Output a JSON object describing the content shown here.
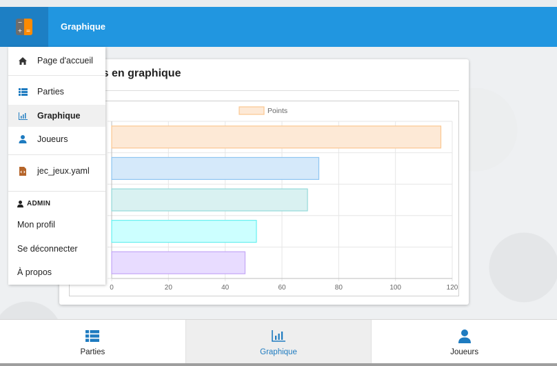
{
  "app": {
    "title": "Graphique",
    "logo_icon": "calculator-icon",
    "accent": "#2196e0"
  },
  "card": {
    "title_visible": "sultats en graphique"
  },
  "drawer": {
    "items": [
      {
        "label": "Page d'accueil",
        "icon": "home-icon"
      },
      {
        "label": "Parties",
        "icon": "list-icon"
      },
      {
        "label": "Graphique",
        "icon": "chart-icon",
        "active": true
      },
      {
        "label": "Joueurs",
        "icon": "user-icon"
      },
      {
        "label": "jec_jeux.yaml",
        "icon": "file-code-icon"
      }
    ],
    "admin_section": "ADMIN",
    "admin_items": [
      {
        "label": "Mon profil"
      },
      {
        "label": "Se déconnecter"
      },
      {
        "label": "À propos"
      }
    ]
  },
  "bottom_nav": [
    {
      "label": "Parties",
      "icon": "list-icon"
    },
    {
      "label": "Graphique",
      "icon": "chart-icon",
      "active": true
    },
    {
      "label": "Joueurs",
      "icon": "user-icon"
    }
  ],
  "chart_data": {
    "type": "bar",
    "orientation": "horizontal",
    "categories": [
      "",
      "",
      "",
      "",
      ""
    ],
    "series": [
      {
        "name": "Points",
        "values": [
          116,
          73,
          69,
          51,
          47
        ]
      }
    ],
    "bar_fills": [
      "#fde9d6",
      "#d5e9fa",
      "#d9f1f1",
      "#ccffff",
      "#e8dcff"
    ],
    "bar_strokes": [
      "#fbc791",
      "#8ec5f1",
      "#94d9d9",
      "#66f0f0",
      "#c3a6f6"
    ],
    "xlim": [
      0,
      120
    ],
    "x_ticks": [
      "0",
      "20",
      "40",
      "60",
      "80",
      "100",
      "120"
    ],
    "legend_position": "top",
    "grid": true,
    "xlabel": "",
    "ylabel": ""
  }
}
